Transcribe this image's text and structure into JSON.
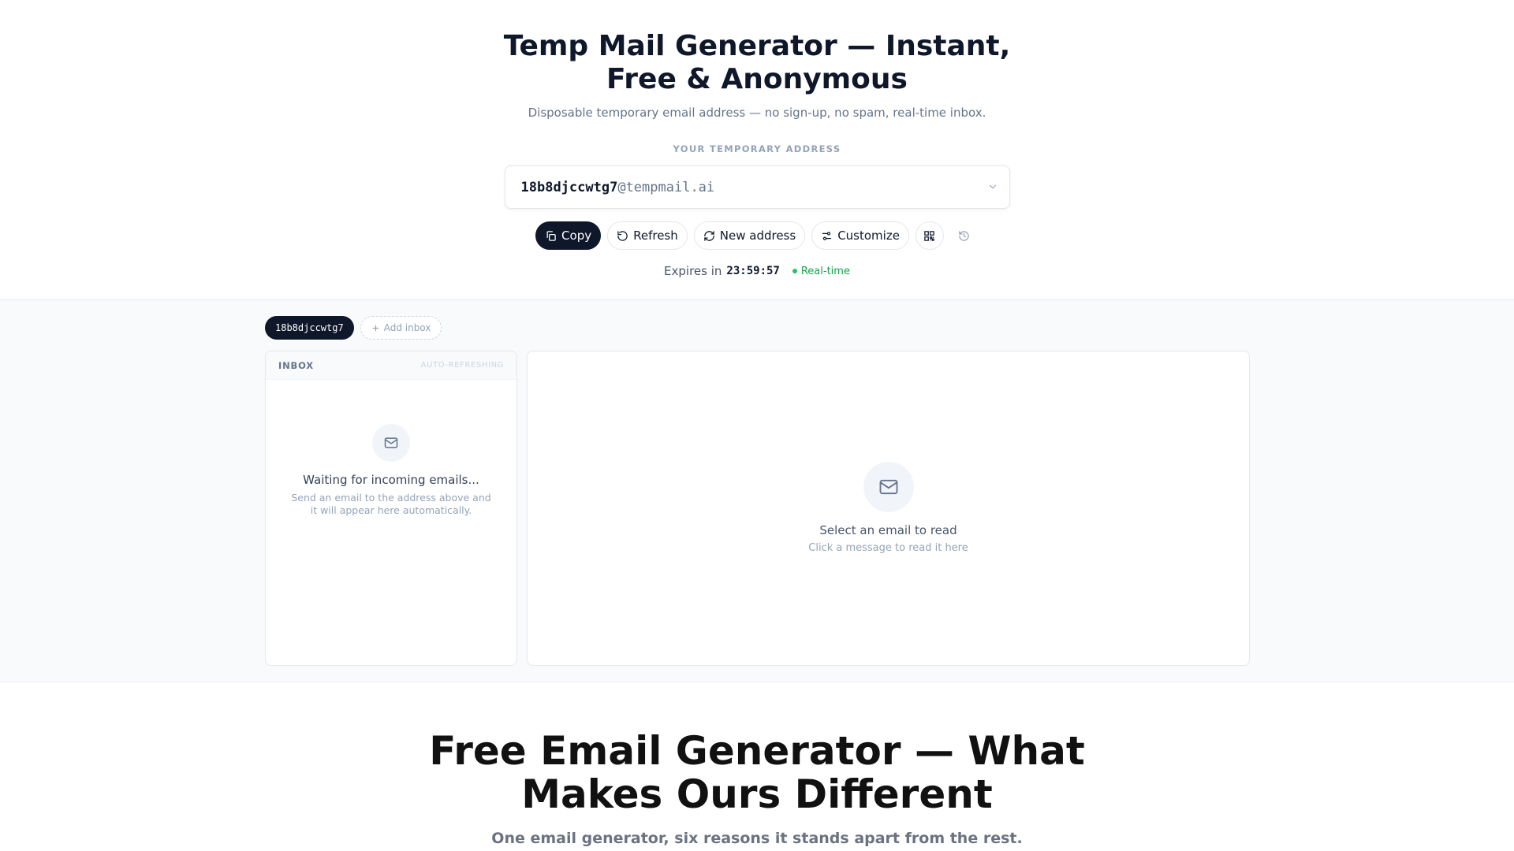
{
  "hero": {
    "title": "Temp Mail Generator — Instant, Free & Anonymous",
    "subtitle": "Disposable temporary email address — no sign-up, no spam, real-time inbox.",
    "address_label": "YOUR TEMPORARY ADDRESS"
  },
  "address": {
    "user": "18b8djccwtg7",
    "domain": "@tempmail.ai"
  },
  "actions": {
    "copy": "Copy",
    "refresh": "Refresh",
    "new_address": "New address",
    "customize": "Customize"
  },
  "expiry": {
    "prefix": "Expires in",
    "time": "23:59:57",
    "realtime": "Real-time"
  },
  "inbox_tabs": {
    "active": "18b8djccwtg7",
    "add": "Add inbox"
  },
  "inbox": {
    "title": "INBOX",
    "status": "AUTO-REFRESHING",
    "empty_title": "Waiting for incoming emails...",
    "empty_desc": "Send an email to the address above and it will appear here automatically."
  },
  "reader": {
    "empty_title": "Select an email to read",
    "empty_desc": "Click a message to read it here"
  },
  "features": {
    "title": "Free Email Generator — What Makes Ours Different",
    "subtitle": "One email generator, six reasons it stands apart from the rest."
  },
  "icons": [
    "copy-icon",
    "refresh-icon",
    "new-address-icon",
    "customize-icon",
    "qr-code-icon",
    "history-icon",
    "chevron-down-icon",
    "plus-icon",
    "mail-icon"
  ],
  "colors": {
    "primary": "#0f172a",
    "accent_green": "#22c55e",
    "muted": "#94a3b8"
  }
}
